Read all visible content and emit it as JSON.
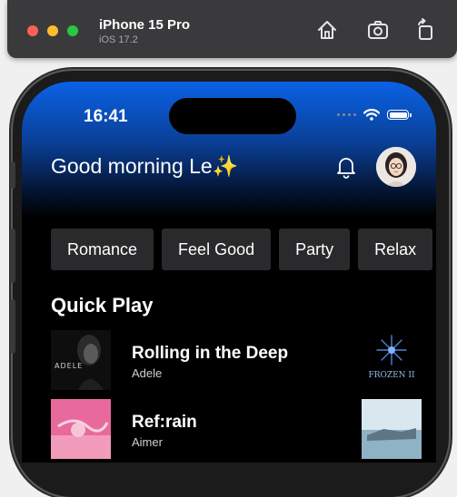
{
  "toolbar": {
    "device_name": "iPhone 15 Pro",
    "os_version": "iOS 17.2",
    "buttons": [
      "home-icon",
      "screenshot-icon",
      "rotate-icon"
    ]
  },
  "status_bar": {
    "time": "16:41"
  },
  "header": {
    "greeting": "Good morning Le✨"
  },
  "chips": [
    "Romance",
    "Feel Good",
    "Party",
    "Relax"
  ],
  "quick_play": {
    "title": "Quick Play",
    "items": [
      {
        "title": "Rolling in the Deep",
        "artist": "Adele",
        "cover_text": "ADELE",
        "side_cover_text": "FROZEN II"
      },
      {
        "title": "Ref:rain",
        "artist": "Aimer"
      }
    ]
  },
  "colors": {
    "header_top": "#0a62e6",
    "chip_bg": "#2a2a2c",
    "background": "#000000"
  }
}
